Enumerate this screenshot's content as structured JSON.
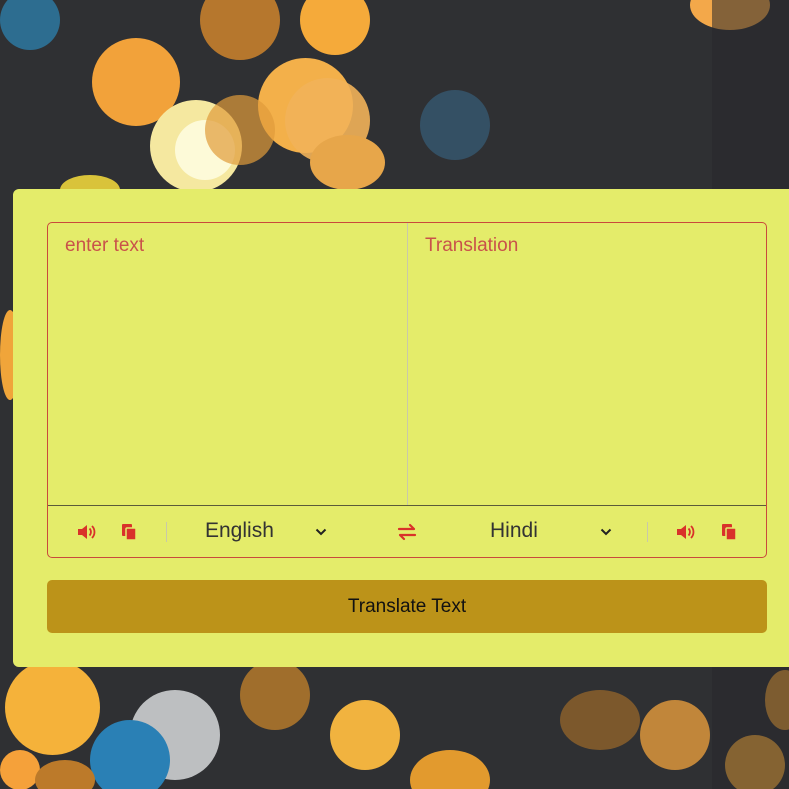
{
  "input": {
    "placeholder": "enter text",
    "value": ""
  },
  "output": {
    "placeholder": "Translation",
    "value": ""
  },
  "source_language": {
    "selected": "English"
  },
  "target_language": {
    "selected": "Hindi"
  },
  "translate_button": {
    "label": "Translate Text"
  },
  "icons": {
    "source_speak": "volume-icon",
    "source_copy": "copy-icon",
    "swap": "exchange-icon",
    "target_speak": "volume-icon",
    "target_copy": "copy-icon",
    "dropdown": "chevron-down-icon"
  },
  "colors": {
    "card_background": "#e4ec6a",
    "accent_red": "#c94a3b",
    "button_background": "#bc9319",
    "page_background": "#2f3033"
  }
}
